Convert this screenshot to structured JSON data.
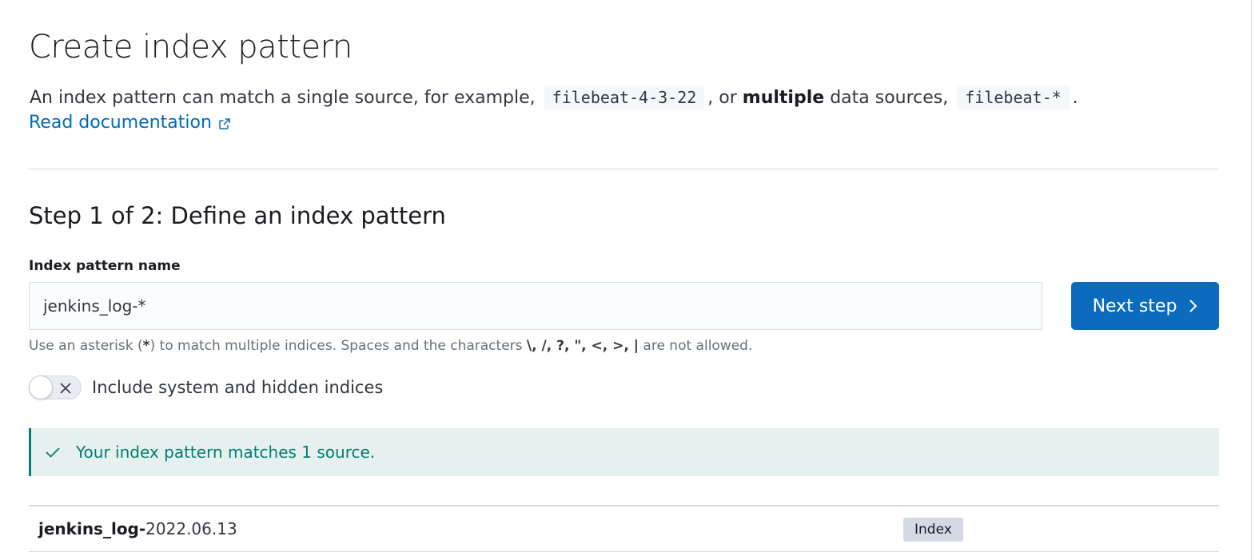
{
  "header": {
    "title": "Create index pattern",
    "description_part1": "An index pattern can match a single source, for example,",
    "example_single": "filebeat-4-3-22",
    "description_part2": ", or",
    "description_bold": "multiple",
    "description_part3": "data sources,",
    "example_multiple": "filebeat-*",
    "description_end": ".",
    "doc_link_label": "Read documentation",
    "doc_link_icon": "external-link-icon"
  },
  "step": {
    "title": "Step 1 of 2: Define an index pattern",
    "field_label": "Index pattern name",
    "input_value": "jenkins_log-*",
    "next_button_label": "Next step",
    "next_button_icon": "chevron-right-icon",
    "help_prefix": "Use an asterisk (",
    "help_asterisk": "*",
    "help_middle": ") to match multiple indices. Spaces and the characters",
    "help_chars": "\\, /, ?, \", <, >, |",
    "help_suffix": "are not allowed.",
    "toggle_label": "Include system and hidden indices",
    "toggle_on": false
  },
  "callout": {
    "text": "Your index pattern matches 1 source.",
    "icon": "check-icon",
    "color": "#017d73"
  },
  "results": [
    {
      "name_bold": "jenkins_log-",
      "name_rest": "2022.06.13",
      "badge": "Index"
    }
  ],
  "colors": {
    "primary": "#0d6bbd",
    "link": "#006bb8",
    "success": "#017d73",
    "success_bg": "#e6f1ef",
    "border": "#d3dae6"
  }
}
